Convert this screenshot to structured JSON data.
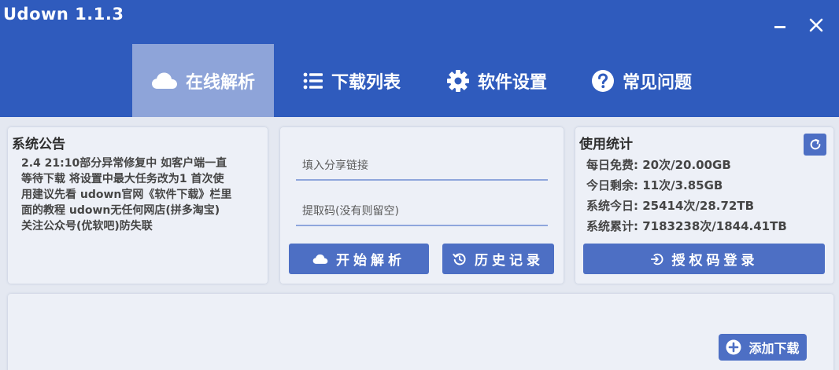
{
  "app": {
    "title": "Udown 1.1.3"
  },
  "window_controls": {
    "minimize_icon": "minimize-icon",
    "close_icon": "close-icon"
  },
  "tabs": [
    {
      "label": "在线解析",
      "icon": "cloud-icon",
      "active": true
    },
    {
      "label": "下载列表",
      "icon": "list-icon",
      "active": false
    },
    {
      "label": "软件设置",
      "icon": "gear-icon",
      "active": false
    },
    {
      "label": "常见问题",
      "icon": "question-icon",
      "active": false
    }
  ],
  "notice": {
    "title": "系统公告",
    "text": "2.4  21:10部分异常修复中 如客户端一直\n等待下载 将设置中最大任务改为1 首次使\n用建议先看 udown官网《软件下载》栏里\n面的教程 udown无任何网店(拼多淘宝)\n关注公众号(优软吧)防失联"
  },
  "parse": {
    "link_placeholder": "填入分享链接",
    "code_placeholder": "提取码(没有则留空)",
    "start_label": "开始解析",
    "history_label": "历史记录"
  },
  "stats": {
    "title": "使用统计",
    "rows": [
      {
        "label": "每日免费:",
        "value": "20次/20.00GB"
      },
      {
        "label": "今日剩余:",
        "value": "11次/3.85GB"
      },
      {
        "label": "系统今日:",
        "value": "25414次/28.72TB"
      },
      {
        "label": "系统累计:",
        "value": "7183238次/1844.41TB"
      }
    ],
    "auth_label": "授权码登录"
  },
  "download": {
    "add_label": "添加下载"
  },
  "colors": {
    "header": "#2f5bbd",
    "active_tab": "#8ea4d9",
    "button": "#4d6fc4",
    "panel": "#edf0f7",
    "input_underline": "#8fa6dc"
  }
}
